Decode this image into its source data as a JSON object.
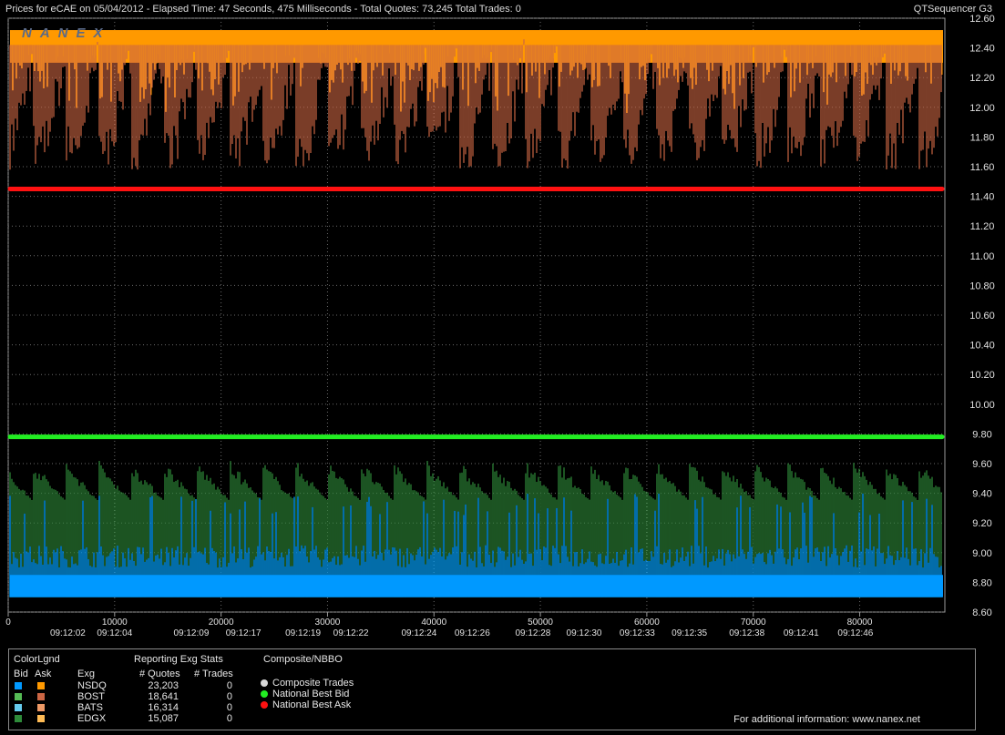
{
  "header": {
    "title": "Prices for  eCAE  on  05/04/2012  -  Elapsed Time: 47 Seconds, 475 Milliseconds  -  Total Quotes: 73,245  Total Trades: 0",
    "app": "QTSequencer G3",
    "watermark": "NANEX"
  },
  "chart_data": {
    "type": "area",
    "y_ticks": [
      "12.60",
      "12.40",
      "12.20",
      "12.00",
      "11.80",
      "11.60",
      "11.40",
      "11.20",
      "11.00",
      "10.80",
      "10.60",
      "10.40",
      "10.20",
      "10.00",
      "9.80",
      "9.60",
      "9.40",
      "9.20",
      "9.00",
      "8.80",
      "8.60"
    ],
    "ylim": [
      8.6,
      12.6
    ],
    "x_ticks": [
      "0",
      "10000",
      "20000",
      "30000",
      "40000",
      "50000",
      "60000",
      "70000",
      "80000"
    ],
    "xlim": [
      0,
      88000
    ],
    "time_ticks": [
      "09:12:02",
      "09:12:04",
      "09:12:09",
      "09:12:17",
      "09:12:19",
      "09:12:22",
      "09:12:24",
      "09:12:26",
      "09:12:28",
      "09:12:30",
      "09:12:33",
      "09:12:35",
      "09:12:38",
      "09:12:41",
      "09:12:46"
    ],
    "time_tick_positions": [
      5600,
      10000,
      17200,
      22100,
      27700,
      32200,
      38600,
      43600,
      49300,
      54100,
      59100,
      64000,
      69400,
      74500,
      79600
    ],
    "national_best_ask": 11.45,
    "national_best_bid": 9.78,
    "ask_band": {
      "top": 12.52,
      "low_min": 11.58,
      "low_max": 11.9
    },
    "bid_band": {
      "bottom": 8.7,
      "high_min": 9.35,
      "high_max": 9.63,
      "blue_top": 9.05
    },
    "legend": {
      "colorlegend_title": "ColorLgnd",
      "bid_label": "Bid",
      "ask_label": "Ask",
      "exg_label": "Exg",
      "stats_title": "Reporting Exg Stats",
      "quotes_label": "# Quotes",
      "trades_label": "# Trades",
      "composite_title": "Composite/NBBO",
      "exchanges": [
        {
          "name": "NSDQ",
          "quotes": "23,203",
          "trades": "0",
          "bid_color": "#0099ff",
          "ask_color": "#ff9900"
        },
        {
          "name": "BOST",
          "quotes": "18,641",
          "trades": "0",
          "bid_color": "#55bb55",
          "ask_color": "#cc6644"
        },
        {
          "name": "BATS",
          "quotes": "16,314",
          "trades": "0",
          "bid_color": "#66ccee",
          "ask_color": "#ee9966"
        },
        {
          "name": "EDGX",
          "quotes": "15,087",
          "trades": "0",
          "bid_color": "#2e8b3a",
          "ask_color": "#ffbb55"
        }
      ],
      "composite": [
        {
          "label": "Composite Trades",
          "color": "#d8d8d8"
        },
        {
          "label": "National Best Bid",
          "color": "#22ee22"
        },
        {
          "label": "National Best Ask",
          "color": "#ff1111"
        }
      ]
    }
  },
  "footer": {
    "info": "For additional information: www.nanex.net"
  }
}
